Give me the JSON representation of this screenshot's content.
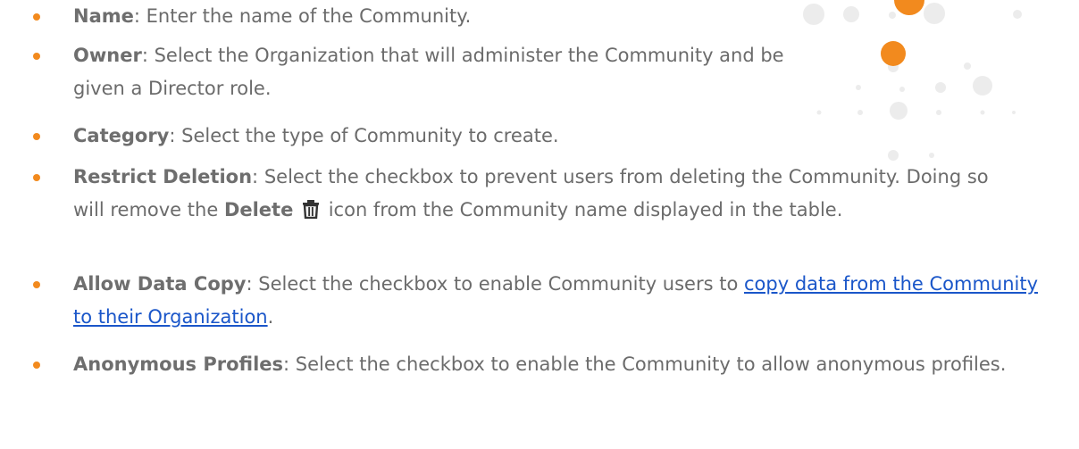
{
  "items": [
    {
      "term": "Name",
      "text": "Enter the name of the Community."
    },
    {
      "term": "Owner",
      "text": "Select the Organization that will administer the Community and be given a Director role."
    },
    {
      "term": "Category",
      "text": "Select the type of Community to create."
    },
    {
      "term": "Restrict Deletion",
      "text_1": "Select the checkbox to prevent users from deleting the Community. Doing so will remove the",
      "bold_word": "Delete",
      "icon": "trash-icon",
      "text_2": "icon from the Community name displayed in the table."
    },
    {
      "term": "Allow Data Copy",
      "text_1": "Select the checkbox to enable Community users to",
      "link_text": "copy data from the Community to their Organization",
      "text_2": "."
    },
    {
      "term": "Anonymous Profiles",
      "text": "Select the checkbox to enable the Community to allow anonymous profiles."
    }
  ],
  "colors": {
    "bullet": "#f28a1e",
    "text": "#6b6b6b",
    "link": "#1a56c9",
    "decor_dots": "#e9e9e9",
    "accent_orange": "#f28a1e"
  }
}
